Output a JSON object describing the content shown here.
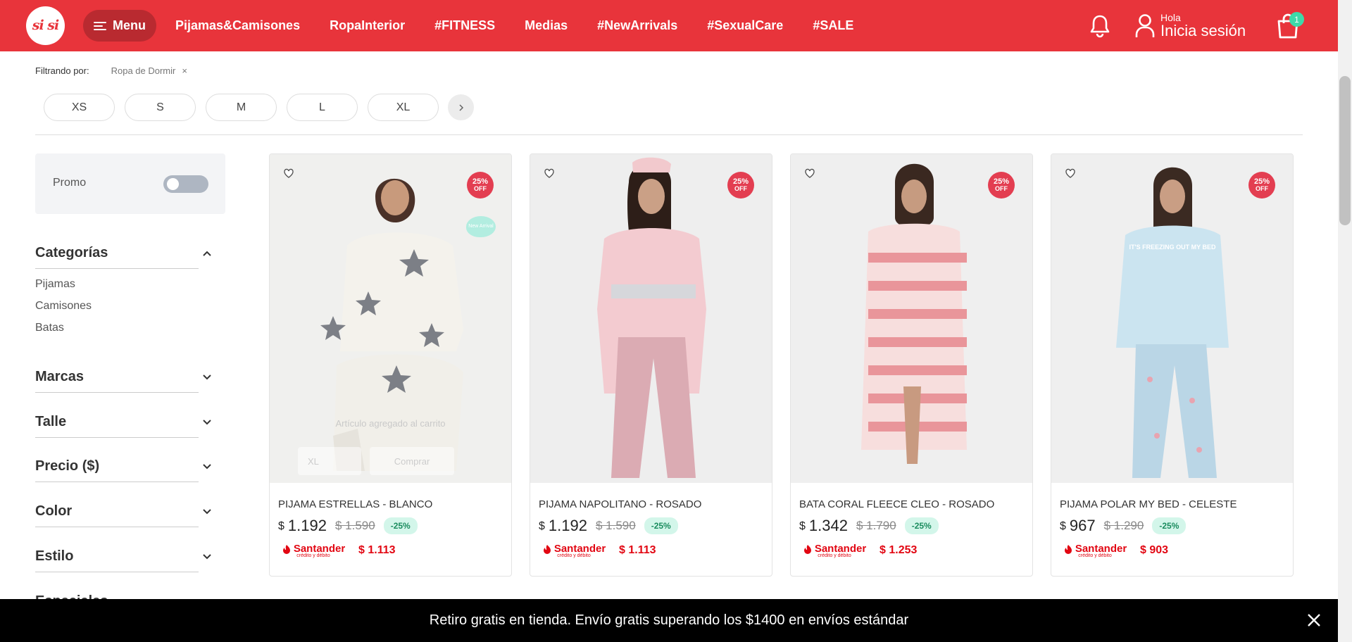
{
  "header": {
    "logo_text": "si si",
    "menu_label": "Menu",
    "nav": [
      "Pijamas&Camisones",
      "RopaInterior",
      "#FITNESS",
      "Medias",
      "#NewArrivals",
      "#SexualCare",
      "#SALE"
    ],
    "user_greeting": "Hola",
    "user_login": "Inicia sesión",
    "cart_count": "1",
    "colors": {
      "brand": "#e8343b",
      "badge": "#3ed9a9"
    }
  },
  "filters": {
    "label": "Filtrando por:",
    "active": "Ropa de Dormir",
    "remove": "×",
    "sizes": [
      "XS",
      "S",
      "M",
      "L",
      "XL"
    ]
  },
  "sidebar": {
    "promo_label": "Promo",
    "promo_on": false,
    "sections": [
      {
        "title": "Categorías",
        "expanded": true,
        "items": [
          "Pijamas",
          "Camisones",
          "Batas"
        ]
      },
      {
        "title": "Marcas",
        "expanded": false
      },
      {
        "title": "Talle",
        "expanded": false
      },
      {
        "title": "Precio ($)",
        "expanded": false
      },
      {
        "title": "Color",
        "expanded": false
      },
      {
        "title": "Estilo",
        "expanded": false
      },
      {
        "title": "Especiales",
        "expanded": false
      }
    ]
  },
  "products": [
    {
      "name": "PIJAMA ESTRELLAS - BLANCO",
      "currency": "$",
      "price": "1.192",
      "old_price": "$ 1.590",
      "discount": "-25%",
      "badge_top": "25%",
      "badge_bottom": "OFF",
      "bank_price": "$ 1.113",
      "new_arrival": "New Arrival",
      "ghost_added": "Artículo agregado al carrito",
      "ghost_size": "XL",
      "ghost_buy": "Comprar"
    },
    {
      "name": "PIJAMA NAPOLITANO - ROSADO",
      "currency": "$",
      "price": "1.192",
      "old_price": "$ 1.590",
      "discount": "-25%",
      "badge_top": "25%",
      "badge_bottom": "OFF",
      "bank_price": "$ 1.113"
    },
    {
      "name": "BATA CORAL FLEECE CLEO - ROSADO",
      "currency": "$",
      "price": "1.342",
      "old_price": "$ 1.790",
      "discount": "-25%",
      "badge_top": "25%",
      "badge_bottom": "OFF",
      "bank_price": "$ 1.253"
    },
    {
      "name": "PIJAMA POLAR MY BED - CELESTE",
      "currency": "$",
      "price": "967",
      "old_price": "$ 1.290",
      "discount": "-25%",
      "badge_top": "25%",
      "badge_bottom": "OFF",
      "bank_price": "$ 903",
      "shirt_text": "IT'S FREEZING OUT MY BED"
    }
  ],
  "bank": {
    "name": "Santander",
    "sub": "crédito y débito"
  },
  "banner": {
    "text": "Retiro gratis en tienda. Envío gratis superando los $1400 en envíos estándar"
  }
}
